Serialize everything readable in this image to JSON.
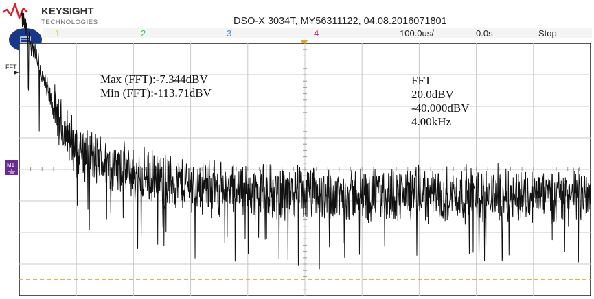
{
  "brand": {
    "name": "KEYSIGHT",
    "subtitle": "TECHNOLOGIES",
    "logo_color": "#e31b23"
  },
  "header": {
    "instrument": "DSO-X 3034T, MY56311122, 04.08.2016071801",
    "channels": [
      {
        "label": "1",
        "color": "#e8d51a"
      },
      {
        "label": "2",
        "color": "#2ecc40"
      },
      {
        "label": "3",
        "color": "#3a8fd9"
      },
      {
        "label": "4",
        "color": "#c2187a"
      }
    ],
    "timebase": "100.0us/",
    "delay": "0.0s",
    "run_state": "Stop"
  },
  "markers": {
    "fft_marker": "FFT",
    "math_marker": "M1"
  },
  "measurements": {
    "max": "Max (FFT):-7.344dBV",
    "min": "Min (FFT):-113.71dBV"
  },
  "fft_info": {
    "title": "FFT",
    "scale": "20.0dBV",
    "offset": "-40.000dBV",
    "span": "4.00kHz"
  },
  "colors": {
    "grid": "#c8c8c8",
    "trace": "#111111",
    "threshold": "#e8a33a",
    "trigger": "#f0a020",
    "math": "#6a2c91"
  },
  "chart_data": {
    "type": "line",
    "series": [
      {
        "values": [
          -8,
          -30,
          -52,
          -62,
          -66,
          -70,
          -72,
          -74,
          -75,
          -76,
          -77,
          -78,
          -78,
          -79,
          -79,
          -80,
          -80,
          -80,
          -80,
          -80,
          -80,
          -80,
          -80,
          -80,
          -80,
          -80,
          -80,
          -80,
          -80,
          -80,
          -80
        ]
      }
    ],
    "ylim": [
      -120,
      -20
    ],
    "threshold_level": -113.71,
    "grid": true
  }
}
